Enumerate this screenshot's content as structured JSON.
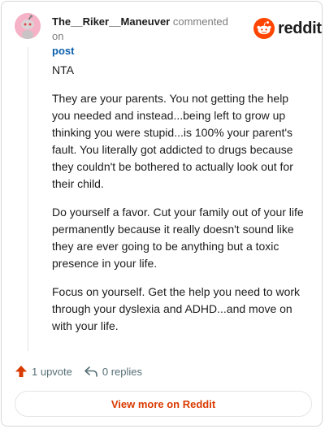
{
  "header": {
    "username": "The__Riker__Maneuver",
    "action_text": "commented on",
    "post_link": "post"
  },
  "brand": {
    "logo_word": "reddit",
    "logo_color": "#ff4500",
    "icon": "reddit-snoo-icon"
  },
  "comment": {
    "paragraphs": [
      "NTA",
      "They are your parents. You not getting the help you needed and instead...being left to grow up thinking you were stupid...is 100% your parent's fault. You literally got addicted to drugs because they couldn't be bothered to actually look out for their child.",
      "Do yourself a favor. Cut your family out of your life permanently because it really doesn't sound like they are ever going to be anything but a toxic presence in your life.",
      "Focus on yourself. Get the help you need to work through your dyslexia and ADHD...and move on with your life."
    ]
  },
  "actions": {
    "upvote_label": "1 upvote",
    "reply_label": "0 replies",
    "upvote_color": "#d93a00"
  },
  "footer": {
    "view_more_label": "View more on Reddit"
  }
}
